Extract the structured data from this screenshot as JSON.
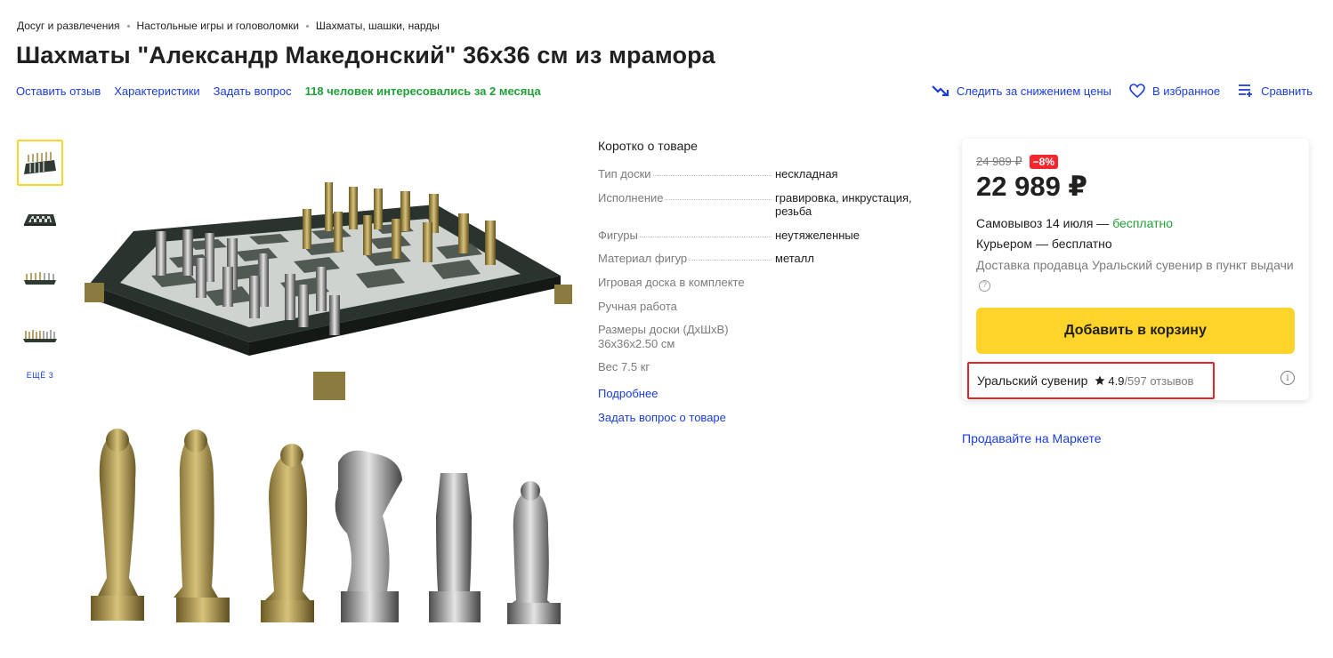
{
  "breadcrumb": [
    "Досуг и развлечения",
    "Настольные игры и головоломки",
    "Шахматы, шашки, нарды"
  ],
  "title": "Шахматы \"Александр Македонский\" 36x36 см из мрамора",
  "actions": {
    "review": "Оставить отзыв",
    "specs": "Характеристики",
    "question": "Задать вопрос",
    "interest": "118 человек интересовались за 2 месяца"
  },
  "right_actions": {
    "track_price": "Следить за снижением цены",
    "favorite": "В избранное",
    "compare": "Сравнить"
  },
  "gallery": {
    "more": "ЕЩЁ 3"
  },
  "specs": {
    "heading": "Коротко о товаре",
    "rows": [
      {
        "k": "Тип доски",
        "v": "нескладная"
      },
      {
        "k": "Исполнение",
        "v": "гравировка, инкрустация, резьба"
      },
      {
        "k": "Фигуры",
        "v": "неутяжеленные"
      },
      {
        "k": "Материал фигур",
        "v": "металл"
      }
    ],
    "singles": [
      "Игровая доска в комплекте",
      "Ручная работа",
      "Размеры доски (ДхШхВ)",
      "36х36х2.50 см",
      "Вес 7.5 кг"
    ],
    "more_link": "Подробнее",
    "ask_link": "Задать вопрос о товаре"
  },
  "buybox": {
    "old_price": "24 989 ₽",
    "discount": "−8%",
    "price": "22 989 ₽",
    "pickup_label": "Самовывоз 14 июля — ",
    "pickup_free": "бесплатно",
    "courier": "Курьером — бесплатно",
    "seller_delivery": "Доставка продавца Уральский сувенир в пункт выдачи",
    "cart_button": "Добавить в корзину",
    "seller_name": "Уральский сувенир",
    "rating": "4.9",
    "reviews": "/597 отзывов"
  },
  "sell_link": "Продавайте на Маркете",
  "colors": {
    "accent_link": "#1a3dd8",
    "green": "#21a038",
    "cart_yellow": "#fed42b",
    "discount_red": "#f5262c",
    "highlight_red": "#e0252b"
  }
}
